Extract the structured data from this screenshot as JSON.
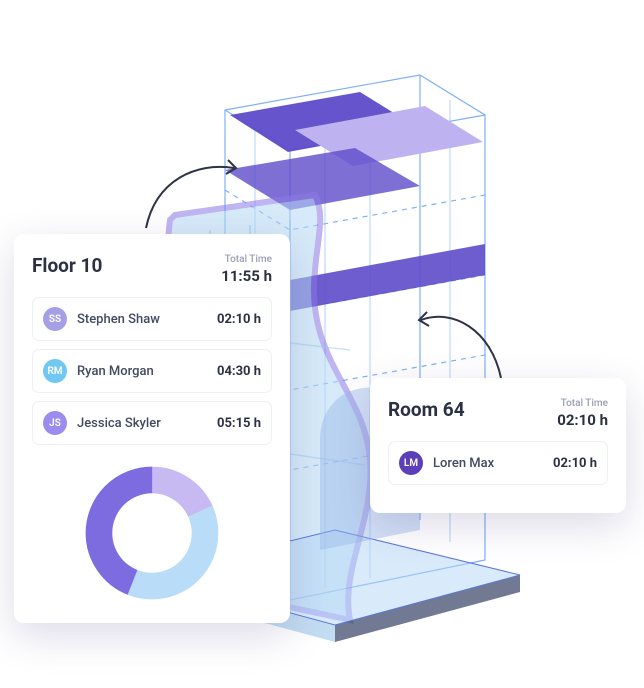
{
  "floor_card": {
    "title": "Floor 10",
    "total_label": "Total Time",
    "total_value": "11:55 h",
    "people": [
      {
        "initials": "SS",
        "name": "Stephen Shaw",
        "time": "02:10 h",
        "avatar_class": "avatar-purple"
      },
      {
        "initials": "RM",
        "name": "Ryan Morgan",
        "time": "04:30 h",
        "avatar_class": "avatar-blue"
      },
      {
        "initials": "JS",
        "name": "Jessica Skyler",
        "time": "05:15 h",
        "avatar_class": "avatar-violet"
      }
    ]
  },
  "room_card": {
    "title": "Room 64",
    "total_label": "Total Time",
    "total_value": "02:10 h",
    "people": [
      {
        "initials": "LM",
        "name": "Loren Max",
        "time": "02:10 h",
        "avatar_class": "avatar-dark"
      }
    ]
  },
  "chart_data": {
    "type": "pie",
    "title": "",
    "series": [
      {
        "name": "Stephen Shaw",
        "value": 130,
        "color": "#C7B9F2"
      },
      {
        "name": "Ryan Morgan",
        "value": 270,
        "color": "#B9DCF8"
      },
      {
        "name": "Jessica Skyler",
        "value": 315,
        "color": "#7C6CE0"
      }
    ]
  }
}
